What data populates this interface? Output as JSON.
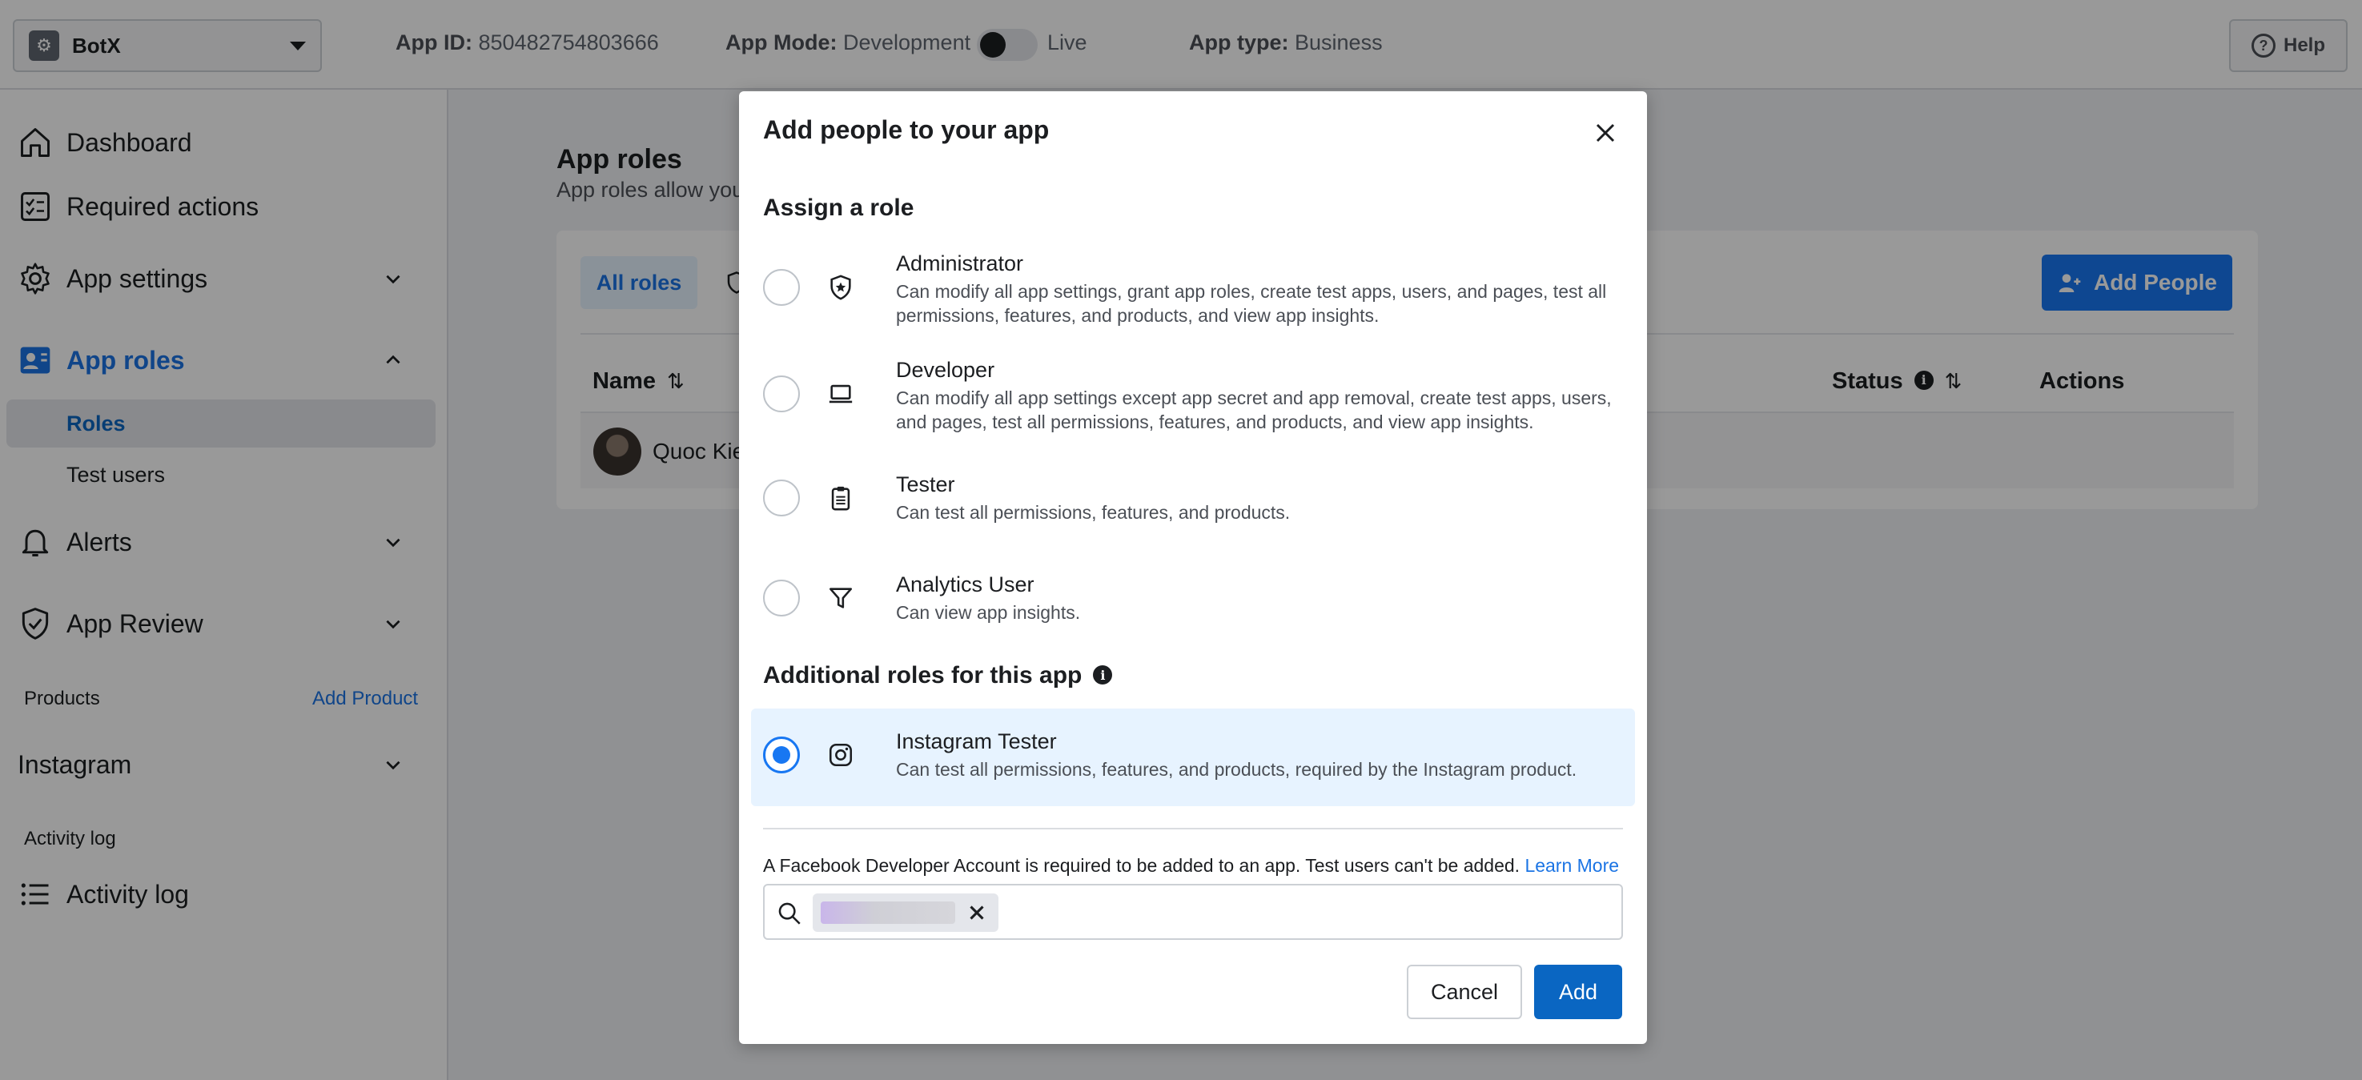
{
  "topbar": {
    "app_name": "BotX",
    "app_id_label": "App ID:",
    "app_id_value": "850482754803666",
    "mode_label": "App Mode:",
    "mode_value": "Development",
    "mode_live": "Live",
    "type_label": "App type:",
    "type_value": "Business",
    "help_label": "Help"
  },
  "sidebar": {
    "dashboard": "Dashboard",
    "required_actions": "Required actions",
    "app_settings": "App settings",
    "app_roles": "App roles",
    "roles": "Roles",
    "test_users": "Test users",
    "alerts": "Alerts",
    "app_review": "App Review",
    "products_label": "Products",
    "add_product": "Add Product",
    "instagram": "Instagram",
    "activity_log_label": "Activity log",
    "activity_log": "Activity log"
  },
  "main": {
    "title": "App roles",
    "description": "App roles allow you",
    "all_roles_tab": "All roles",
    "add_people": "Add People",
    "columns": {
      "name": "Name",
      "status": "Status",
      "actions": "Actions"
    },
    "row_name": "Quoc Kie"
  },
  "modal": {
    "title": "Add people to your app",
    "assign_role": "Assign a role",
    "roles": [
      {
        "name": "Administrator",
        "desc": "Can modify all app settings, grant app roles, create test apps, users, and pages, test all permissions, features, and products, and view app insights."
      },
      {
        "name": "Developer",
        "desc": "Can modify all app settings except app secret and app removal, create test apps, users, and pages, test all permissions, features, and products, and view app insights."
      },
      {
        "name": "Tester",
        "desc": "Can test all permissions, features, and products."
      },
      {
        "name": "Analytics User",
        "desc": "Can view app insights."
      }
    ],
    "additional_roles": "Additional roles for this app",
    "instagram_role": {
      "name": "Instagram Tester",
      "desc": "Can test all permissions, features, and products, required by the Instagram product."
    },
    "notice": "A Facebook Developer Account is required to be added to an app. Test users can't be added.",
    "learn_more": "Learn More",
    "cancel": "Cancel",
    "add": "Add"
  },
  "icons": {
    "colors": {
      "primary": "#1877f2",
      "link": "#1b74e4",
      "add_button": "#0a66c2"
    }
  }
}
